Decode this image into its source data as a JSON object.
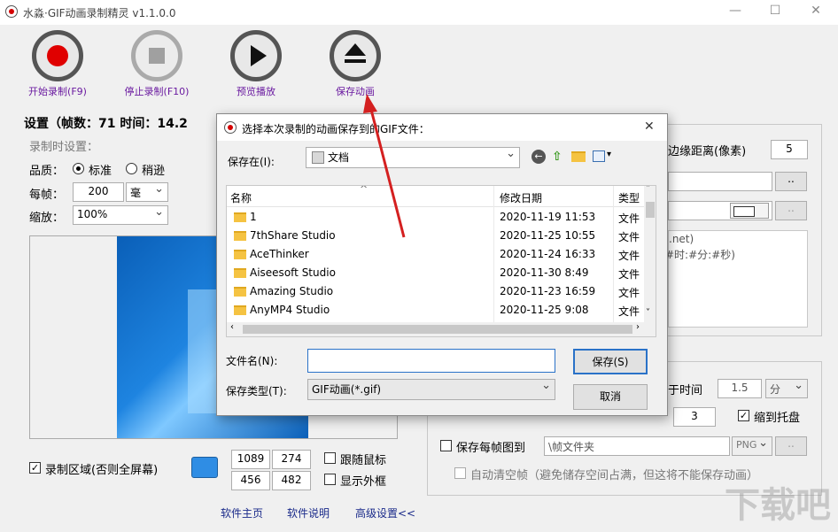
{
  "window": {
    "title": "水淼·GIF动画录制精灵 v1.1.0.0",
    "minimize": "—",
    "maximize": "☐",
    "close": "✕"
  },
  "toolbar": {
    "start_label": "开始录制(F9)",
    "stop_label": "停止录制(F10)",
    "preview_label": "预览播放",
    "save_label": "保存动画"
  },
  "settings": {
    "header": "设置（帧数：71 时间：14.2",
    "record_settings": "录制时设置：",
    "quality_label": "品质：",
    "quality_standard": "标准",
    "quality_inferior": "稍逊",
    "per_frame_label": "每帧：",
    "per_frame_value": "200",
    "per_frame_unit": "毫",
    "zoom_label": "缩放：",
    "zoom_value": "100%",
    "record_area_label": "录制区域(否则全屏幕)",
    "area": {
      "x": "1089",
      "y": "274",
      "w": "456",
      "h": "482"
    },
    "follow_mouse": "跟随鼠标",
    "show_frame": "显示外框"
  },
  "right_panel": {
    "edge_distance_label": "边缘距离(像素)",
    "edge_distance_value": "5",
    "browse": "..",
    "text_line1": ".net)",
    "text_line2": "#时:#分:#秒)",
    "time_label": "于时间",
    "time_value": "1.5",
    "time_unit": "分",
    "count_value": "3",
    "minimize_tray": "缩到托盘",
    "save_each_frame": "保存每帧图到",
    "frame_folder": "\\帧文件夹",
    "frame_format": "PNG",
    "auto_clear": "自动清空帧（避免储存空间占满，但这将不能保存动画）"
  },
  "footer": {
    "home": "软件主页",
    "help": "软件说明",
    "advanced": "高级设置<<"
  },
  "dialog": {
    "title": "选择本次录制的动画保存到的GIF文件：",
    "close": "✕",
    "save_in_label": "保存在(I):",
    "save_in_value": "文档",
    "columns": {
      "name": "名称",
      "date": "修改日期",
      "type": "类型"
    },
    "files": [
      {
        "name": "1",
        "date": "2020-11-19 11:53",
        "type": "文件"
      },
      {
        "name": "7thShare Studio",
        "date": "2020-11-25 10:55",
        "type": "文件"
      },
      {
        "name": "AceThinker",
        "date": "2020-11-24 16:33",
        "type": "文件"
      },
      {
        "name": "Aiseesoft Studio",
        "date": "2020-11-30 8:49",
        "type": "文件"
      },
      {
        "name": "Amazing Studio",
        "date": "2020-11-23 16:59",
        "type": "文件"
      },
      {
        "name": "AnyMP4 Studio",
        "date": "2020-11-25 9:08",
        "type": "文件"
      }
    ],
    "filename_label": "文件名(N):",
    "filename_value": "",
    "filetype_label": "保存类型(T):",
    "filetype_value": "GIF动画(*.gif)",
    "save_button": "保存(S)",
    "cancel_button": "取消"
  },
  "watermark": "下载吧",
  "colors": {
    "accent_red": "#d40000",
    "link": "#1a2a8a",
    "label_purple": "#6a1aa0",
    "arrow": "#d42020"
  }
}
